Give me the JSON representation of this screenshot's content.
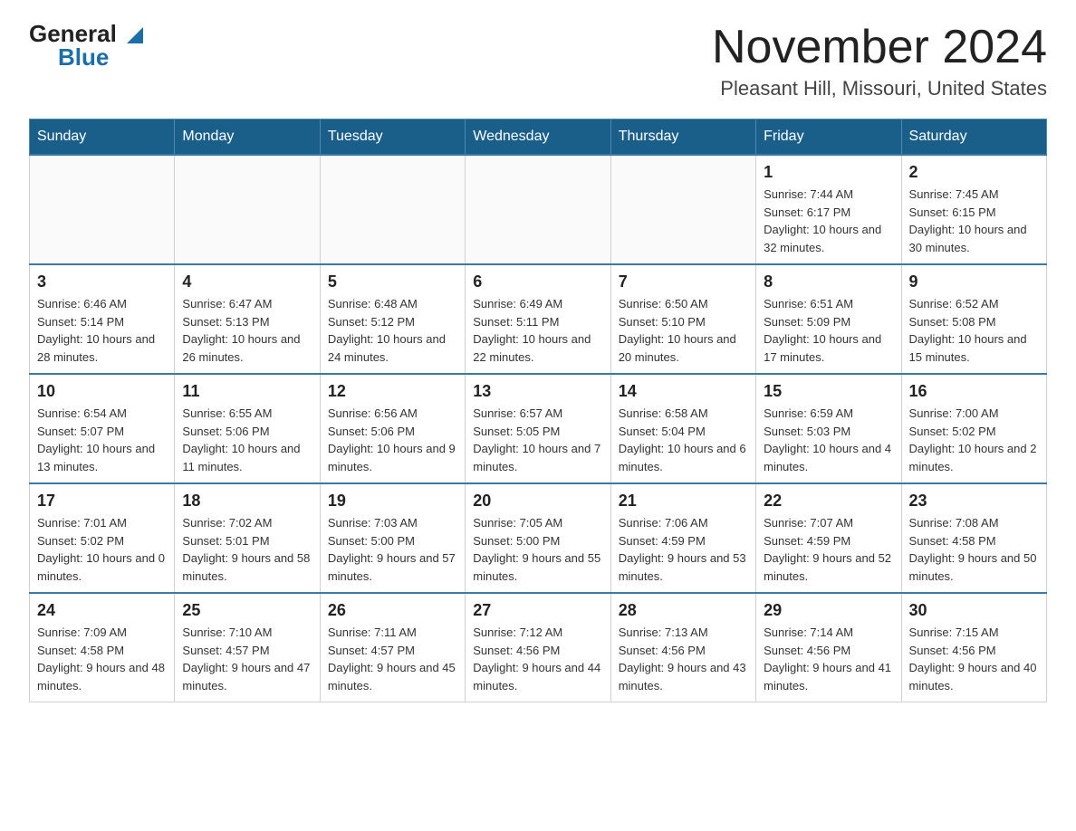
{
  "header": {
    "logo_line1": "General",
    "logo_line2": "Blue",
    "month_title": "November 2024",
    "location": "Pleasant Hill, Missouri, United States"
  },
  "weekdays": [
    "Sunday",
    "Monday",
    "Tuesday",
    "Wednesday",
    "Thursday",
    "Friday",
    "Saturday"
  ],
  "weeks": [
    [
      {
        "day": "",
        "sunrise": "",
        "sunset": "",
        "daylight": ""
      },
      {
        "day": "",
        "sunrise": "",
        "sunset": "",
        "daylight": ""
      },
      {
        "day": "",
        "sunrise": "",
        "sunset": "",
        "daylight": ""
      },
      {
        "day": "",
        "sunrise": "",
        "sunset": "",
        "daylight": ""
      },
      {
        "day": "",
        "sunrise": "",
        "sunset": "",
        "daylight": ""
      },
      {
        "day": "1",
        "sunrise": "Sunrise: 7:44 AM",
        "sunset": "Sunset: 6:17 PM",
        "daylight": "Daylight: 10 hours and 32 minutes."
      },
      {
        "day": "2",
        "sunrise": "Sunrise: 7:45 AM",
        "sunset": "Sunset: 6:15 PM",
        "daylight": "Daylight: 10 hours and 30 minutes."
      }
    ],
    [
      {
        "day": "3",
        "sunrise": "Sunrise: 6:46 AM",
        "sunset": "Sunset: 5:14 PM",
        "daylight": "Daylight: 10 hours and 28 minutes."
      },
      {
        "day": "4",
        "sunrise": "Sunrise: 6:47 AM",
        "sunset": "Sunset: 5:13 PM",
        "daylight": "Daylight: 10 hours and 26 minutes."
      },
      {
        "day": "5",
        "sunrise": "Sunrise: 6:48 AM",
        "sunset": "Sunset: 5:12 PM",
        "daylight": "Daylight: 10 hours and 24 minutes."
      },
      {
        "day": "6",
        "sunrise": "Sunrise: 6:49 AM",
        "sunset": "Sunset: 5:11 PM",
        "daylight": "Daylight: 10 hours and 22 minutes."
      },
      {
        "day": "7",
        "sunrise": "Sunrise: 6:50 AM",
        "sunset": "Sunset: 5:10 PM",
        "daylight": "Daylight: 10 hours and 20 minutes."
      },
      {
        "day": "8",
        "sunrise": "Sunrise: 6:51 AM",
        "sunset": "Sunset: 5:09 PM",
        "daylight": "Daylight: 10 hours and 17 minutes."
      },
      {
        "day": "9",
        "sunrise": "Sunrise: 6:52 AM",
        "sunset": "Sunset: 5:08 PM",
        "daylight": "Daylight: 10 hours and 15 minutes."
      }
    ],
    [
      {
        "day": "10",
        "sunrise": "Sunrise: 6:54 AM",
        "sunset": "Sunset: 5:07 PM",
        "daylight": "Daylight: 10 hours and 13 minutes."
      },
      {
        "day": "11",
        "sunrise": "Sunrise: 6:55 AM",
        "sunset": "Sunset: 5:06 PM",
        "daylight": "Daylight: 10 hours and 11 minutes."
      },
      {
        "day": "12",
        "sunrise": "Sunrise: 6:56 AM",
        "sunset": "Sunset: 5:06 PM",
        "daylight": "Daylight: 10 hours and 9 minutes."
      },
      {
        "day": "13",
        "sunrise": "Sunrise: 6:57 AM",
        "sunset": "Sunset: 5:05 PM",
        "daylight": "Daylight: 10 hours and 7 minutes."
      },
      {
        "day": "14",
        "sunrise": "Sunrise: 6:58 AM",
        "sunset": "Sunset: 5:04 PM",
        "daylight": "Daylight: 10 hours and 6 minutes."
      },
      {
        "day": "15",
        "sunrise": "Sunrise: 6:59 AM",
        "sunset": "Sunset: 5:03 PM",
        "daylight": "Daylight: 10 hours and 4 minutes."
      },
      {
        "day": "16",
        "sunrise": "Sunrise: 7:00 AM",
        "sunset": "Sunset: 5:02 PM",
        "daylight": "Daylight: 10 hours and 2 minutes."
      }
    ],
    [
      {
        "day": "17",
        "sunrise": "Sunrise: 7:01 AM",
        "sunset": "Sunset: 5:02 PM",
        "daylight": "Daylight: 10 hours and 0 minutes."
      },
      {
        "day": "18",
        "sunrise": "Sunrise: 7:02 AM",
        "sunset": "Sunset: 5:01 PM",
        "daylight": "Daylight: 9 hours and 58 minutes."
      },
      {
        "day": "19",
        "sunrise": "Sunrise: 7:03 AM",
        "sunset": "Sunset: 5:00 PM",
        "daylight": "Daylight: 9 hours and 57 minutes."
      },
      {
        "day": "20",
        "sunrise": "Sunrise: 7:05 AM",
        "sunset": "Sunset: 5:00 PM",
        "daylight": "Daylight: 9 hours and 55 minutes."
      },
      {
        "day": "21",
        "sunrise": "Sunrise: 7:06 AM",
        "sunset": "Sunset: 4:59 PM",
        "daylight": "Daylight: 9 hours and 53 minutes."
      },
      {
        "day": "22",
        "sunrise": "Sunrise: 7:07 AM",
        "sunset": "Sunset: 4:59 PM",
        "daylight": "Daylight: 9 hours and 52 minutes."
      },
      {
        "day": "23",
        "sunrise": "Sunrise: 7:08 AM",
        "sunset": "Sunset: 4:58 PM",
        "daylight": "Daylight: 9 hours and 50 minutes."
      }
    ],
    [
      {
        "day": "24",
        "sunrise": "Sunrise: 7:09 AM",
        "sunset": "Sunset: 4:58 PM",
        "daylight": "Daylight: 9 hours and 48 minutes."
      },
      {
        "day": "25",
        "sunrise": "Sunrise: 7:10 AM",
        "sunset": "Sunset: 4:57 PM",
        "daylight": "Daylight: 9 hours and 47 minutes."
      },
      {
        "day": "26",
        "sunrise": "Sunrise: 7:11 AM",
        "sunset": "Sunset: 4:57 PM",
        "daylight": "Daylight: 9 hours and 45 minutes."
      },
      {
        "day": "27",
        "sunrise": "Sunrise: 7:12 AM",
        "sunset": "Sunset: 4:56 PM",
        "daylight": "Daylight: 9 hours and 44 minutes."
      },
      {
        "day": "28",
        "sunrise": "Sunrise: 7:13 AM",
        "sunset": "Sunset: 4:56 PM",
        "daylight": "Daylight: 9 hours and 43 minutes."
      },
      {
        "day": "29",
        "sunrise": "Sunrise: 7:14 AM",
        "sunset": "Sunset: 4:56 PM",
        "daylight": "Daylight: 9 hours and 41 minutes."
      },
      {
        "day": "30",
        "sunrise": "Sunrise: 7:15 AM",
        "sunset": "Sunset: 4:56 PM",
        "daylight": "Daylight: 9 hours and 40 minutes."
      }
    ]
  ]
}
